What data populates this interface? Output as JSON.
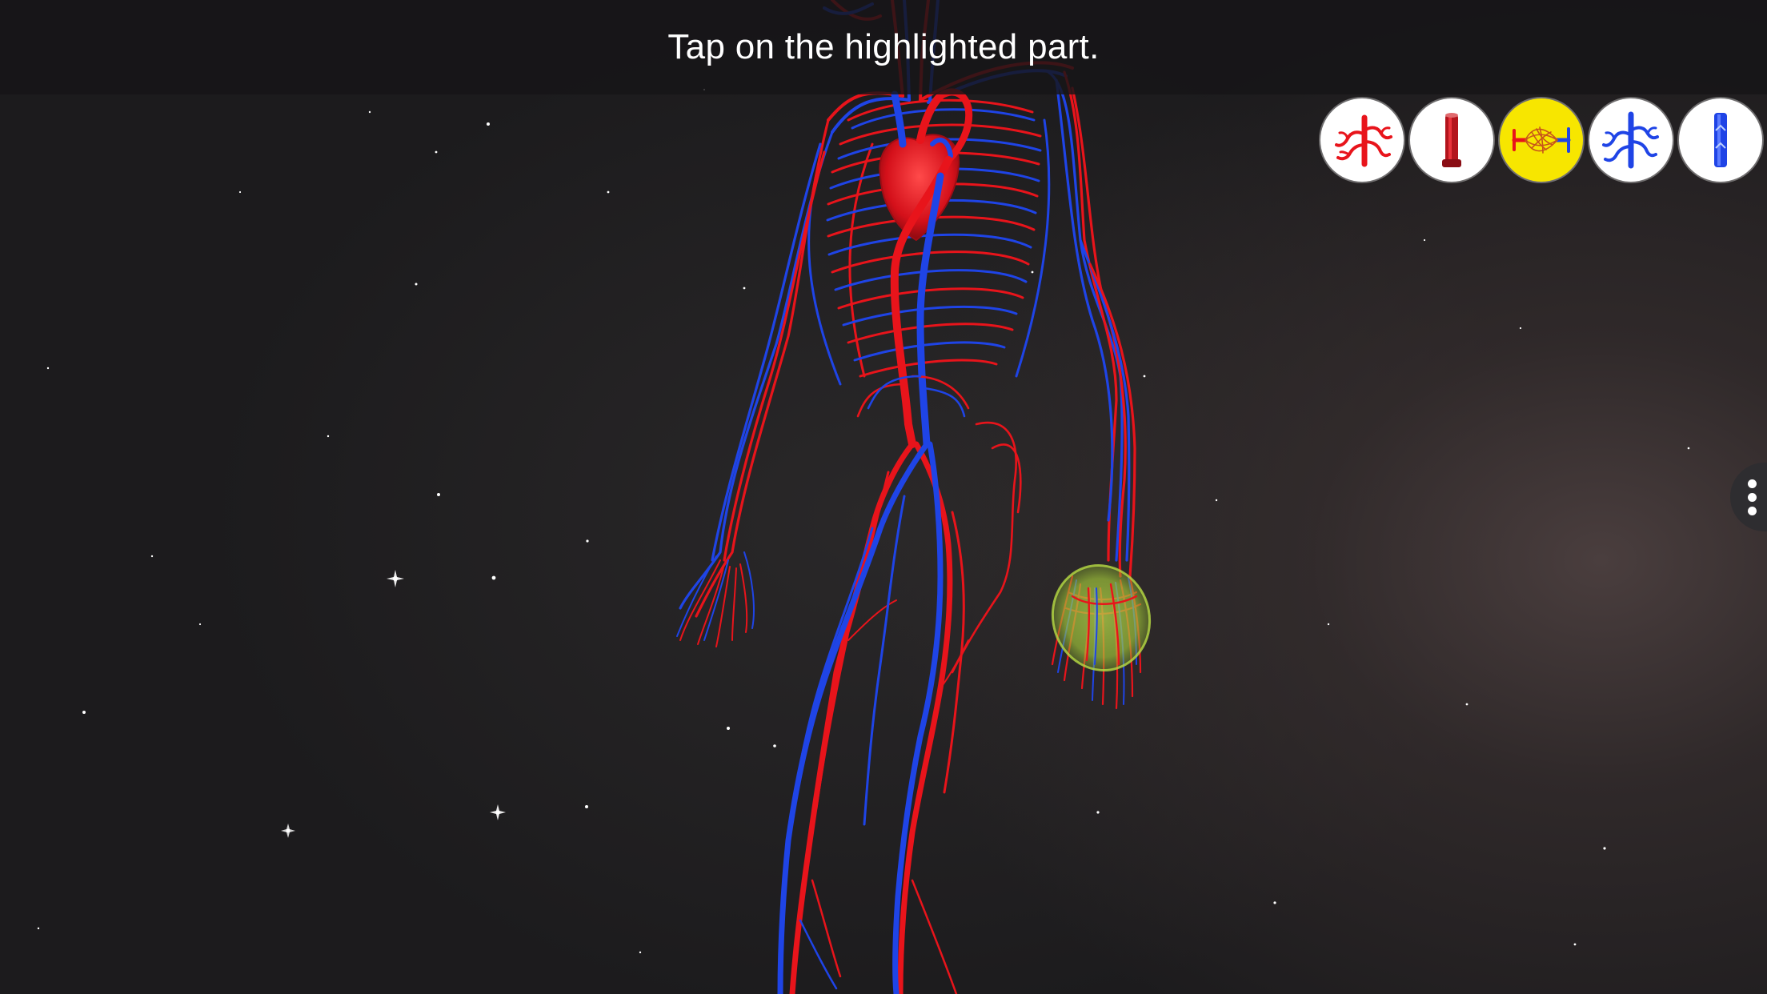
{
  "instruction": {
    "text": "Tap on the highlighted part."
  },
  "vessel_buttons": [
    {
      "icon": "artery-branch-icon",
      "selected": false,
      "color": "#e8141b"
    },
    {
      "icon": "artery-tube-icon",
      "selected": false,
      "color": "#b0141b"
    },
    {
      "icon": "capillary-bed-icon",
      "selected": true,
      "color": "#f7e600"
    },
    {
      "icon": "vein-branch-icon",
      "selected": false,
      "color": "#1a44e0"
    },
    {
      "icon": "vein-tube-icon",
      "selected": false,
      "color": "#1a44e0"
    }
  ],
  "highlight": {
    "color": "#a8d23a",
    "target": "left hand capillaries"
  },
  "colors": {
    "artery": "#e8141b",
    "vein": "#1f44e6",
    "background": "#1b1a1c"
  }
}
